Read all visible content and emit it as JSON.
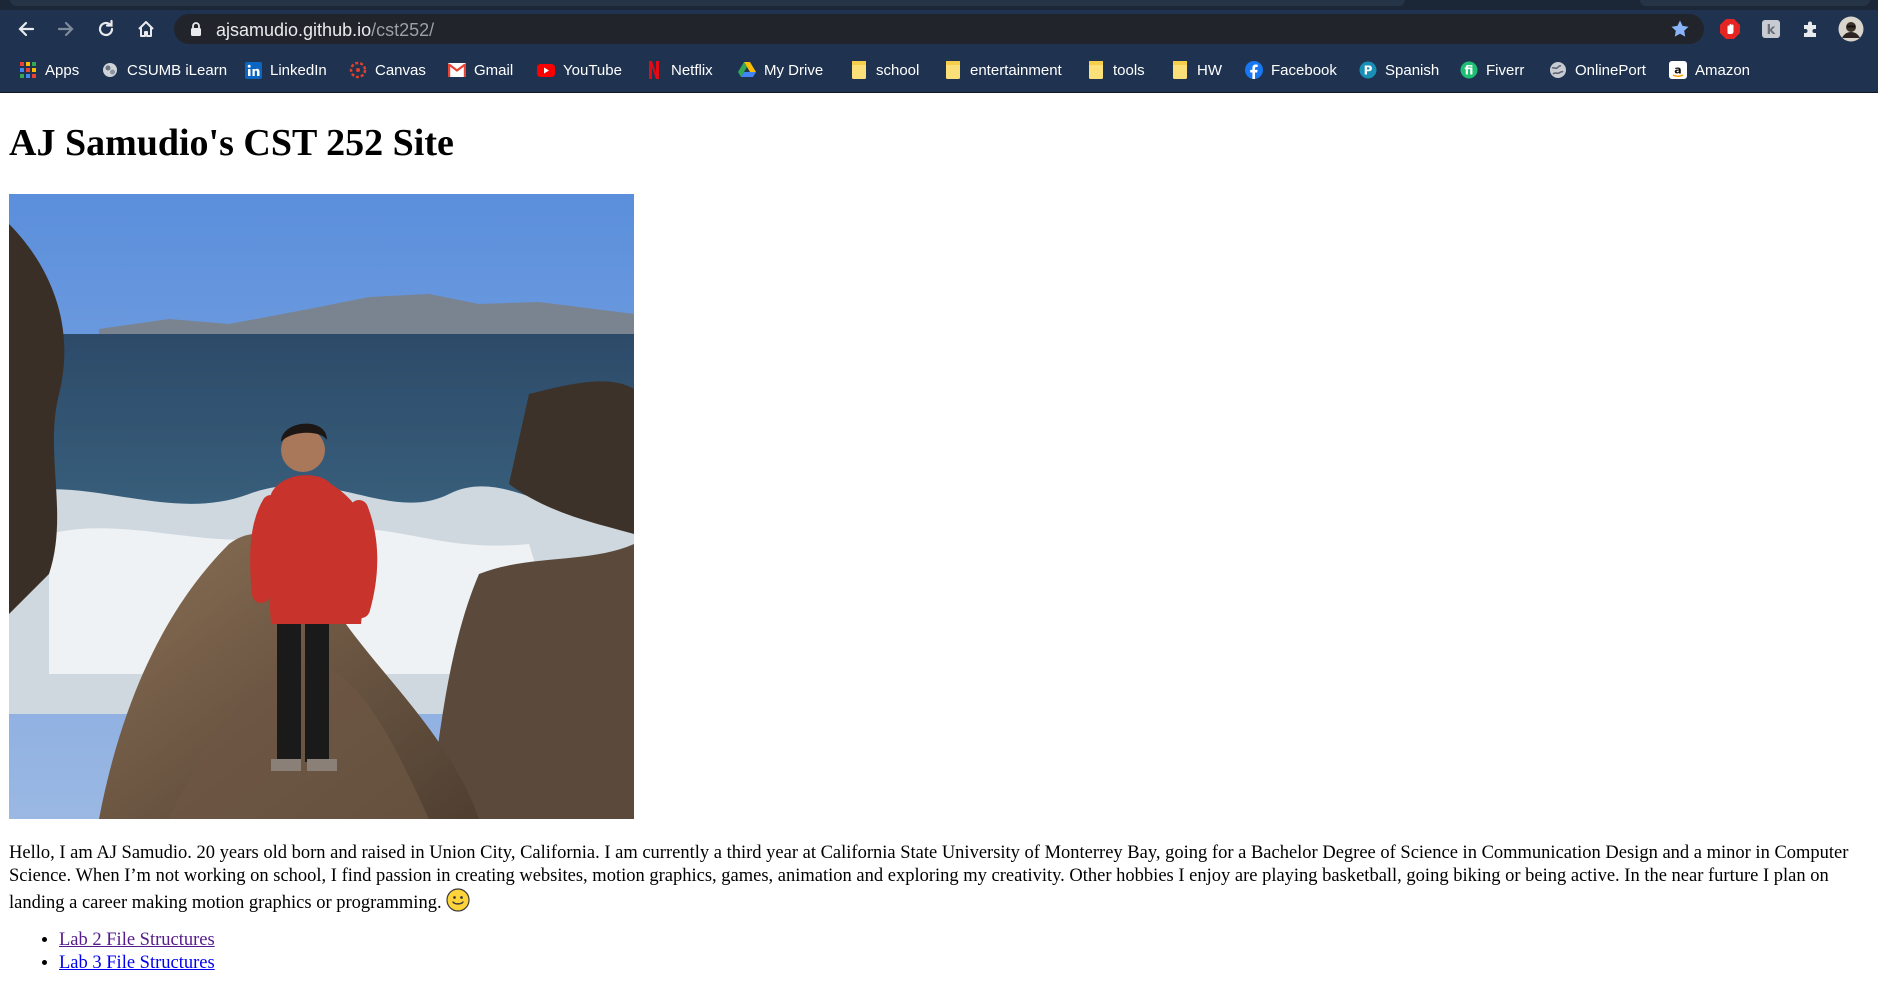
{
  "browser": {
    "url_host": "ajsamudio.github.io",
    "url_path": "/cst252/",
    "nav": {
      "back_icon": "arrow-left-icon",
      "forward_icon": "arrow-right-icon",
      "reload_icon": "reload-icon",
      "home_icon": "home-icon"
    },
    "extensions": [
      "bookmark-star-icon",
      "adblock-hand-icon",
      "extension-k-icon",
      "puzzle-icon",
      "profile-avatar-icon"
    ],
    "bookmarks": [
      {
        "label": "Apps",
        "icon": "apps-grid-icon"
      },
      {
        "label": "CSUMB iLearn",
        "icon": "ilearn-icon"
      },
      {
        "label": "LinkedIn",
        "icon": "linkedin-icon"
      },
      {
        "label": "Canvas",
        "icon": "canvas-icon"
      },
      {
        "label": "Gmail",
        "icon": "gmail-icon"
      },
      {
        "label": "YouTube",
        "icon": "youtube-icon"
      },
      {
        "label": "Netflix",
        "icon": "netflix-icon"
      },
      {
        "label": "My Drive",
        "icon": "google-drive-icon"
      },
      {
        "label": "school",
        "icon": "folder-icon"
      },
      {
        "label": "entertainment",
        "icon": "folder-icon"
      },
      {
        "label": "tools",
        "icon": "folder-icon"
      },
      {
        "label": "HW",
        "icon": "folder-icon"
      },
      {
        "label": "Facebook",
        "icon": "facebook-icon"
      },
      {
        "label": "Spanish",
        "icon": "spanish-p-icon"
      },
      {
        "label": "Fiverr",
        "icon": "fiverr-icon"
      },
      {
        "label": "OnlinePort",
        "icon": "globe-icon"
      },
      {
        "label": "Amazon",
        "icon": "amazon-icon"
      }
    ]
  },
  "page": {
    "title": "AJ Samudio's CST 252 Site",
    "photo_icon": "profile-photo",
    "bio": "Hello, I am AJ Samudio. 20 years old born and raised in Union City, California. I am currently a third year at California State University of Monterrey Bay, going for a Bachelor Degree of Science in Communication Design and a minor in Computer Science. When I’m not working on school, I find passion in creating websites, motion graphics, games, animation and exploring my creativity. Other hobbies I enjoy are playing basketball, going biking or being active. In the near furture I plan on landing a career making motion graphics or programming.",
    "bio_emoji": "smiley-face-icon",
    "links": [
      {
        "label": "Lab 2 File Structures",
        "visited": true
      },
      {
        "label": "Lab 3 File Structures",
        "visited": false
      }
    ]
  },
  "colors": {
    "chrome_bg": "#1f3350",
    "omnibox_bg": "#21242a",
    "link_visited": "#551a8b",
    "link_unvisited": "#0000ee"
  }
}
